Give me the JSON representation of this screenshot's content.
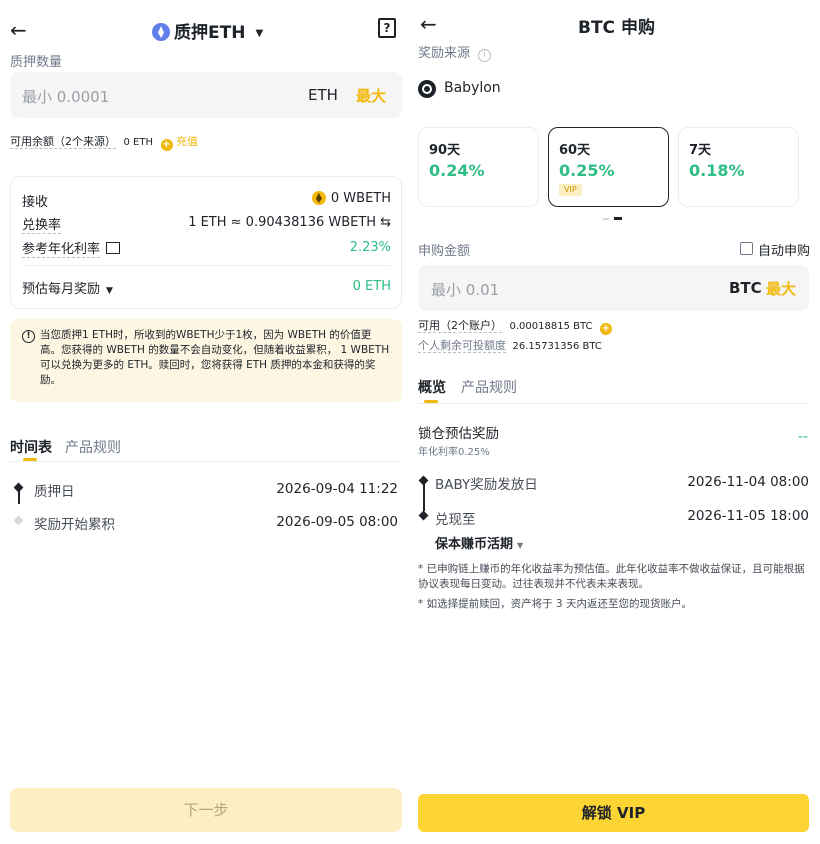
{
  "left": {
    "header": {
      "title": "质押ETH"
    },
    "amount_label": "质押数量",
    "input": {
      "placeholder": "最小 0.0001",
      "unit": "ETH",
      "max_label": "最大"
    },
    "balance": {
      "label": "可用余额（2个来源）",
      "value": "0 ETH",
      "recharge_label": "充值"
    },
    "summary": {
      "receive_label": "接收",
      "receive_value": "0 WBETH",
      "rate_label": "兑换率",
      "rate_value": "1 ETH ≈ 0.90438136 WBETH",
      "apr_label": "参考年化利率",
      "apr_value": "2.23%",
      "monthly_label": "预估每月奖励",
      "monthly_value": "0 ETH"
    },
    "notice": "当您质押1 ETH时，所收到的WBETH少于1枚，因为 WBETH 的价值更高。您获得的 WBETH 的数量不会自动变化，但随着收益累积， 1 WBETH 可以兑换为更多的 ETH。赎回时，您将获得 ETH 质押的本金和获得的奖励。",
    "tabs": [
      "时间表",
      "产品规则"
    ],
    "timeline": [
      {
        "label": "质押日",
        "value": "2026-09-04 11:22"
      },
      {
        "label": "奖励开始累积",
        "value": "2026-09-05 08:00"
      }
    ],
    "next_button": "下一步"
  },
  "right": {
    "header": {
      "title": "BTC 申购"
    },
    "reward_source_label": "奖励来源",
    "provider": "Babylon",
    "terms": [
      {
        "days": "90天",
        "rate": "0.24%"
      },
      {
        "days": "60天",
        "rate": "0.25%",
        "tag": "VIP"
      },
      {
        "days": "7天",
        "rate": "0.18%"
      }
    ],
    "amount_label": "申购金额",
    "auto_label": "自动申购",
    "input": {
      "placeholder": "最小 0.01",
      "unit": "BTC",
      "max_label": "最大"
    },
    "available": {
      "label": "可用（2个账户）",
      "value": "0.00018815 BTC"
    },
    "quota": {
      "label": "个人剩余可投额度",
      "value": "26.15731356 BTC"
    },
    "tabs": [
      "概览",
      "产品规则"
    ],
    "locked_reward": {
      "label": "锁仓预估奖励",
      "sub": "年化利率0.25%",
      "value": "--"
    },
    "timeline": [
      {
        "label": "BABY奖励发放日",
        "value": "2026-11-04 08:00"
      },
      {
        "label": "兑现至",
        "value": "2026-11-05 18:00"
      }
    ],
    "redeem_target": "保本赚币活期",
    "footnotes": [
      "* 已申购链上赚币的年化收益率为预估值。此年化收益率不做收益保证，且可能根据协议表现每日变动。过往表现并不代表未来表现。",
      "* 如选择提前赎回，资产将于 3 天内返还至您的现货账户。"
    ],
    "unlock_button": "解锁 VIP"
  }
}
